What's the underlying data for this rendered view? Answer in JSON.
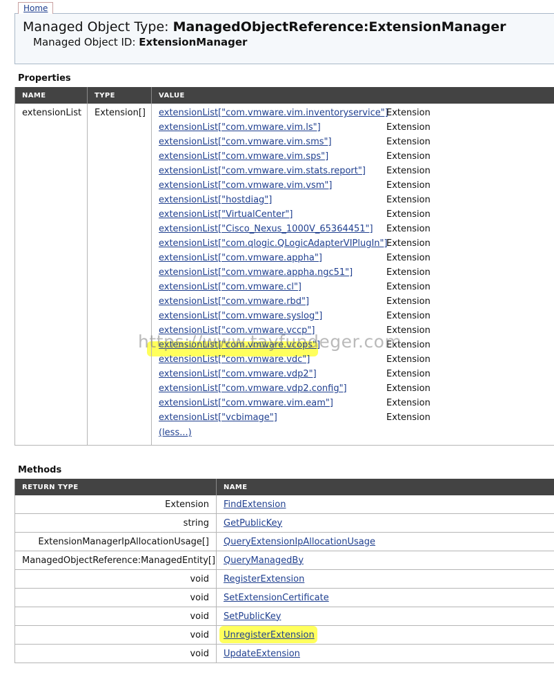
{
  "header": {
    "home_tab": "Home",
    "type_prefix": "Managed Object Type: ",
    "type_value": "ManagedObjectReference:ExtensionManager",
    "id_prefix": "Managed Object ID: ",
    "id_value": "ExtensionManager"
  },
  "properties": {
    "title": "Properties",
    "columns": [
      "NAME",
      "TYPE",
      "VALUE"
    ],
    "row": {
      "name": "extensionList",
      "type": "Extension[]",
      "values": [
        {
          "link": "extensionList[\"com.vmware.vim.inventoryservice\"]",
          "type": "Extension"
        },
        {
          "link": "extensionList[\"com.vmware.vim.ls\"]",
          "type": "Extension"
        },
        {
          "link": "extensionList[\"com.vmware.vim.sms\"]",
          "type": "Extension"
        },
        {
          "link": "extensionList[\"com.vmware.vim.sps\"]",
          "type": "Extension"
        },
        {
          "link": "extensionList[\"com.vmware.vim.stats.report\"]",
          "type": "Extension"
        },
        {
          "link": "extensionList[\"com.vmware.vim.vsm\"]",
          "type": "Extension"
        },
        {
          "link": "extensionList[\"hostdiag\"]",
          "type": "Extension"
        },
        {
          "link": "extensionList[\"VirtualCenter\"]",
          "type": "Extension"
        },
        {
          "link": "extensionList[\"Cisco_Nexus_1000V_65364451\"]",
          "type": "Extension"
        },
        {
          "link": "extensionList[\"com.qlogic.QLogicAdapterVIPlugIn\"]",
          "type": "Extension"
        },
        {
          "link": "extensionList[\"com.vmware.appha\"]",
          "type": "Extension"
        },
        {
          "link": "extensionList[\"com.vmware.appha.ngc51\"]",
          "type": "Extension"
        },
        {
          "link": "extensionList[\"com.vmware.cl\"]",
          "type": "Extension"
        },
        {
          "link": "extensionList[\"com.vmware.rbd\"]",
          "type": "Extension"
        },
        {
          "link": "extensionList[\"com.vmware.syslog\"]",
          "type": "Extension"
        },
        {
          "link": "extensionList[\"com.vmware.vccp\"]",
          "type": "Extension"
        },
        {
          "link": "extensionList[\"com.vmware.vcops\"]",
          "type": "Extension"
        },
        {
          "link": "extensionList[\"com.vmware.vdc\"]",
          "type": "Extension"
        },
        {
          "link": "extensionList[\"com.vmware.vdp2\"]",
          "type": "Extension"
        },
        {
          "link": "extensionList[\"com.vmware.vdp2.config\"]",
          "type": "Extension"
        },
        {
          "link": "extensionList[\"com.vmware.vim.eam\"]",
          "type": "Extension"
        },
        {
          "link": "extensionList[\"vcbimage\"]",
          "type": "Extension"
        }
      ],
      "less_link": "(less...)"
    }
  },
  "methods": {
    "title": "Methods",
    "columns": [
      "RETURN TYPE",
      "NAME"
    ],
    "rows": [
      {
        "return_type": "Extension",
        "name": "FindExtension"
      },
      {
        "return_type": "string",
        "name": "GetPublicKey"
      },
      {
        "return_type": "ExtensionManagerIpAllocationUsage[]",
        "name": "QueryExtensionIpAllocationUsage"
      },
      {
        "return_type": "ManagedObjectReference:ManagedEntity[]",
        "name": "QueryManagedBy"
      },
      {
        "return_type": "void",
        "name": "RegisterExtension"
      },
      {
        "return_type": "void",
        "name": "SetExtensionCertificate"
      },
      {
        "return_type": "void",
        "name": "SetPublicKey"
      },
      {
        "return_type": "void",
        "name": "UnregisterExtension"
      },
      {
        "return_type": "void",
        "name": "UpdateExtension"
      }
    ]
  },
  "watermark": "https://www.tayfundeger.com",
  "highlight_color": "#ffff40"
}
